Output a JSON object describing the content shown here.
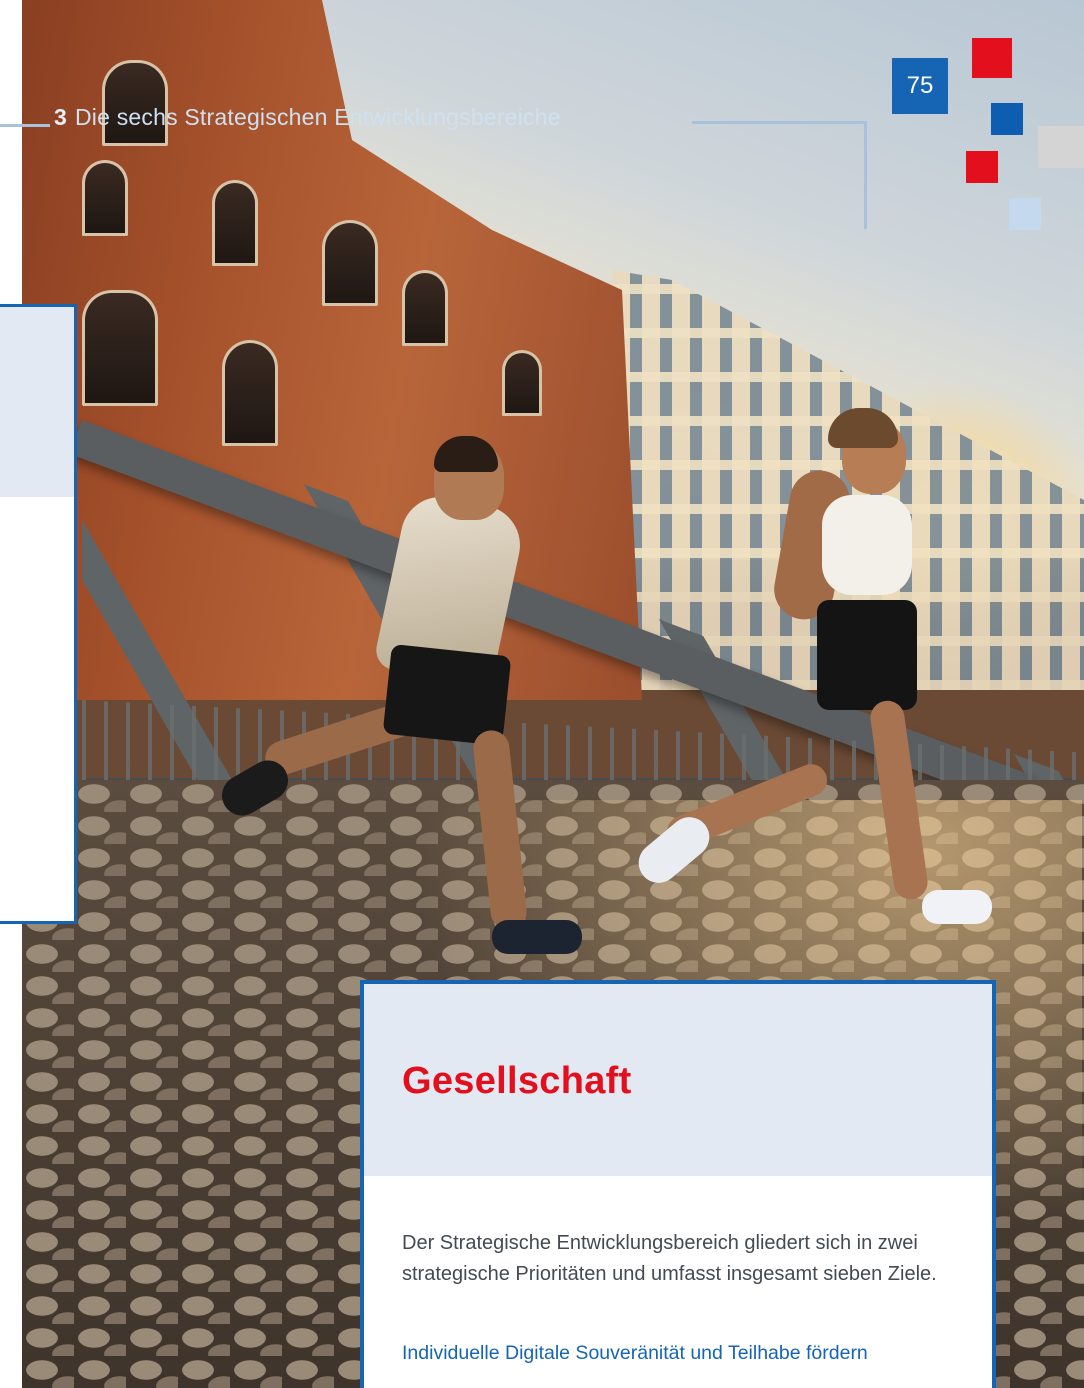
{
  "header": {
    "chapter_number": "3",
    "chapter_title": "Die sechs Strategischen Entwicklungsbereiche",
    "page_number": "75"
  },
  "colors": {
    "brand_blue": "#1565b4",
    "brand_red": "#e30f1d",
    "panel_background": "#e3e9f2",
    "body_text": "#444a52"
  },
  "decorations": [
    "red-square",
    "blue-square",
    "grey-square",
    "red-square",
    "light-blue-square"
  ],
  "photo": {
    "icon": "runners-on-bridge-photo"
  },
  "card": {
    "title": "Gesellschaft",
    "body": "Der Strategische Entwicklungsbereich gliedert sich in zwei strategische Prioritäten und umfasst insgesamt sieben Ziele.",
    "link_text": "Individuelle Digitale Souveränität und Teilhabe fördern"
  }
}
